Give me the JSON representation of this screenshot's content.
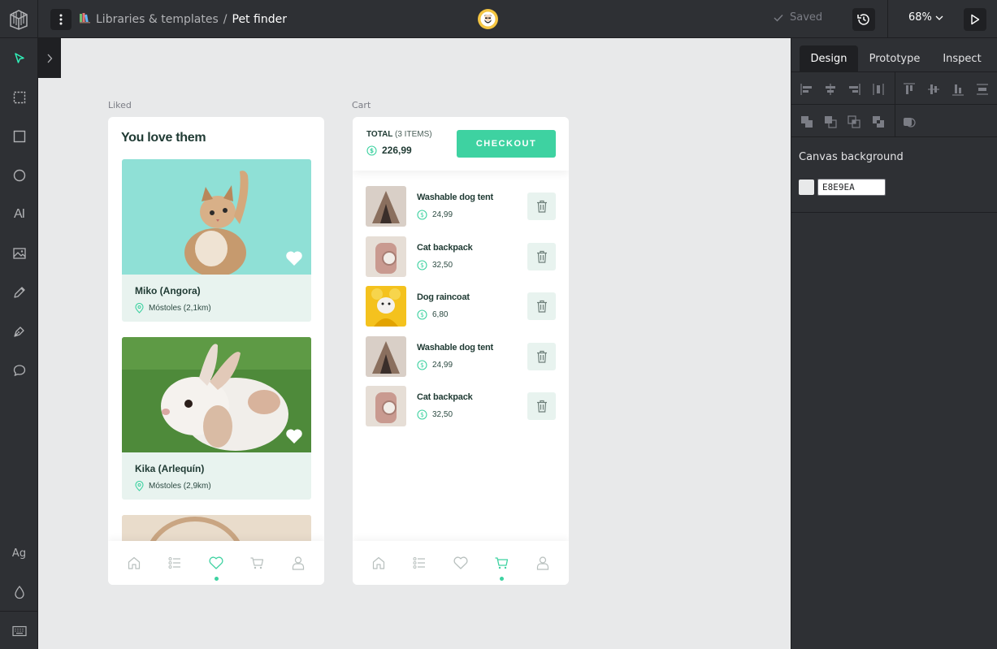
{
  "header": {
    "breadcrumb_parent": "Libraries & templates",
    "breadcrumb_sep": "/",
    "breadcrumb_current": "Pet finder",
    "saved_label": "Saved",
    "zoom": "68%"
  },
  "panel": {
    "tabs": [
      {
        "label": "Design"
      },
      {
        "label": "Prototype"
      },
      {
        "label": "Inspect"
      }
    ],
    "canvas_background_label": "Canvas background",
    "canvas_background_value": "E8E9EA"
  },
  "toolbar": {
    "text_tool": "AI",
    "typography_tool": "Ag"
  },
  "liked": {
    "board_label": "Liked",
    "title": "You love them",
    "pets": [
      {
        "name": "Miko (Angora)",
        "location": "Móstoles (2,1km)"
      },
      {
        "name": "Kika (Arlequín)",
        "location": "Móstoles (2,9km)"
      }
    ]
  },
  "cart": {
    "board_label": "Cart",
    "total_label": "TOTAL",
    "items_count": "(3 ITEMS)",
    "total_value": "226,99",
    "checkout_label": "CHECKOUT",
    "items": [
      {
        "name": "Washable dog tent",
        "price": "24,99"
      },
      {
        "name": "Cat backpack",
        "price": "32,50"
      },
      {
        "name": "Dog raincoat",
        "price": "6,80"
      },
      {
        "name": "Washable dog tent",
        "price": "24,99"
      },
      {
        "name": "Cat backpack",
        "price": "32,50"
      }
    ]
  },
  "colors": {
    "accent": "#3ED2A1",
    "toolbar_active": "#31EFB8",
    "chrome_bg": "#2E3034",
    "canvas_bg": "#E8E9EA"
  }
}
